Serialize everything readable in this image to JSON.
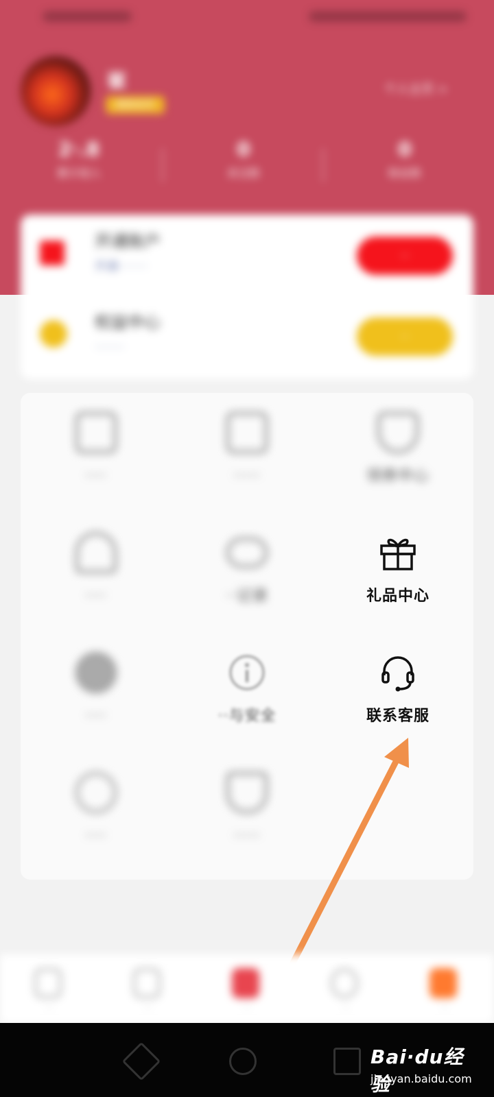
{
  "status_bar": {},
  "profile": {
    "username": "崔\t\t",
    "vip_badge": "超级会员",
    "profile_link": "个人主页 >"
  },
  "stats": [
    {
      "num": "2·.8",
      "label": "累计收入"
    },
    {
      "num": "0",
      "label": "关注数"
    },
    {
      "num": "0",
      "label": "粉丝数"
    }
  ],
  "promo": [
    {
      "title": "开通账户",
      "sub": "开通········",
      "button": "··",
      "color": "#f5141c"
    },
    {
      "title": "权益中心",
      "sub": "········",
      "button": "··",
      "color": "#f0c01c"
    }
  ],
  "menu": [
    {
      "label": "····",
      "icon": "edit-icon",
      "sharp": false
    },
    {
      "label": "·····",
      "icon": "book-icon",
      "sharp": false
    },
    {
      "label": "领券中心",
      "icon": "coupon-icon",
      "sharp": false
    },
    {
      "label": "····",
      "icon": "bell-icon",
      "sharp": false
    },
    {
      "label": "··记录",
      "icon": "cloud-icon",
      "sharp": false
    },
    {
      "label": "礼品中心",
      "icon": "gift-icon",
      "sharp": true
    },
    {
      "label": "····",
      "icon": "settings-icon",
      "sharp": false
    },
    {
      "label": "··与安全",
      "icon": "info-icon",
      "sharp": false
    },
    {
      "label": "联系客服",
      "icon": "headset-icon",
      "sharp": true
    },
    {
      "label": "····",
      "icon": "search-icon",
      "sharp": false
    },
    {
      "label": "·····",
      "icon": "shield-icon",
      "sharp": false
    }
  ],
  "bottom_nav": [
    {
      "label": "··",
      "icon": "home-icon"
    },
    {
      "label": "··",
      "icon": "list-icon"
    },
    {
      "label": "··",
      "icon": "featured-icon"
    },
    {
      "label": "··",
      "icon": "message-icon"
    },
    {
      "label": "··",
      "icon": "profile-icon"
    }
  ],
  "watermark": {
    "brand": "Bai·du经验",
    "url": "jingyan.baidu.com"
  },
  "colors": {
    "header": "#c74a5e",
    "arrow": "#f0904a",
    "accent_orange": "#ff7a2f"
  }
}
